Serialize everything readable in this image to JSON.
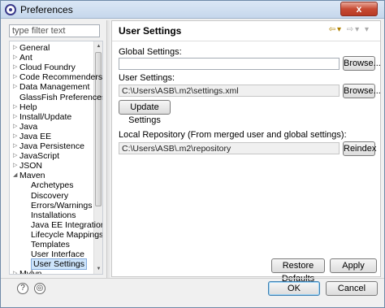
{
  "window": {
    "title": "Preferences",
    "close_label": "x"
  },
  "filter": {
    "placeholder": "type filter text"
  },
  "tree": {
    "items": [
      {
        "label": "General",
        "arrow": "▷",
        "indent": 0
      },
      {
        "label": "Ant",
        "arrow": "▷",
        "indent": 0
      },
      {
        "label": "Cloud Foundry",
        "arrow": "▷",
        "indent": 0
      },
      {
        "label": "Code Recommenders",
        "arrow": "▷",
        "indent": 0
      },
      {
        "label": "Data Management",
        "arrow": "▷",
        "indent": 0
      },
      {
        "label": "GlassFish Preferences",
        "arrow": "",
        "indent": 0
      },
      {
        "label": "Help",
        "arrow": "▷",
        "indent": 0
      },
      {
        "label": "Install/Update",
        "arrow": "▷",
        "indent": 0
      },
      {
        "label": "Java",
        "arrow": "▷",
        "indent": 0
      },
      {
        "label": "Java EE",
        "arrow": "▷",
        "indent": 0
      },
      {
        "label": "Java Persistence",
        "arrow": "▷",
        "indent": 0
      },
      {
        "label": "JavaScript",
        "arrow": "▷",
        "indent": 0
      },
      {
        "label": "JSON",
        "arrow": "▷",
        "indent": 0
      },
      {
        "label": "Maven",
        "arrow": "◢",
        "indent": 0
      },
      {
        "label": "Archetypes",
        "arrow": "",
        "indent": 1
      },
      {
        "label": "Discovery",
        "arrow": "",
        "indent": 1
      },
      {
        "label": "Errors/Warnings",
        "arrow": "",
        "indent": 1
      },
      {
        "label": "Installations",
        "arrow": "",
        "indent": 1
      },
      {
        "label": "Java EE Integration",
        "arrow": "",
        "indent": 1
      },
      {
        "label": "Lifecycle Mappings",
        "arrow": "",
        "indent": 1
      },
      {
        "label": "Templates",
        "arrow": "",
        "indent": 1
      },
      {
        "label": "User Interface",
        "arrow": "",
        "indent": 1
      },
      {
        "label": "User Settings",
        "arrow": "",
        "indent": 1,
        "selected": true
      },
      {
        "label": "Mylyn",
        "arrow": "▷",
        "indent": 0
      }
    ]
  },
  "page": {
    "title": "User Settings",
    "global_settings_label": "Global Settings:",
    "global_settings_value": "",
    "browse_label": "Browse...",
    "user_settings_label": "User Settings:",
    "user_settings_value": "C:\\Users\\ASB\\.m2\\settings.xml",
    "update_settings_label": "Update Settings",
    "local_repo_label": "Local Repository (From merged user and global settings):",
    "local_repo_value": "C:\\Users\\ASB\\.m2\\repository",
    "reindex_label": "Reindex",
    "restore_defaults_label": "Restore Defaults",
    "apply_label": "Apply"
  },
  "footer": {
    "help_icon": "?",
    "import_icon": "◎",
    "ok_label": "OK",
    "cancel_label": "Cancel"
  },
  "colors": {
    "selection": "#cde4fb",
    "nav_arrow": "#b08000"
  }
}
